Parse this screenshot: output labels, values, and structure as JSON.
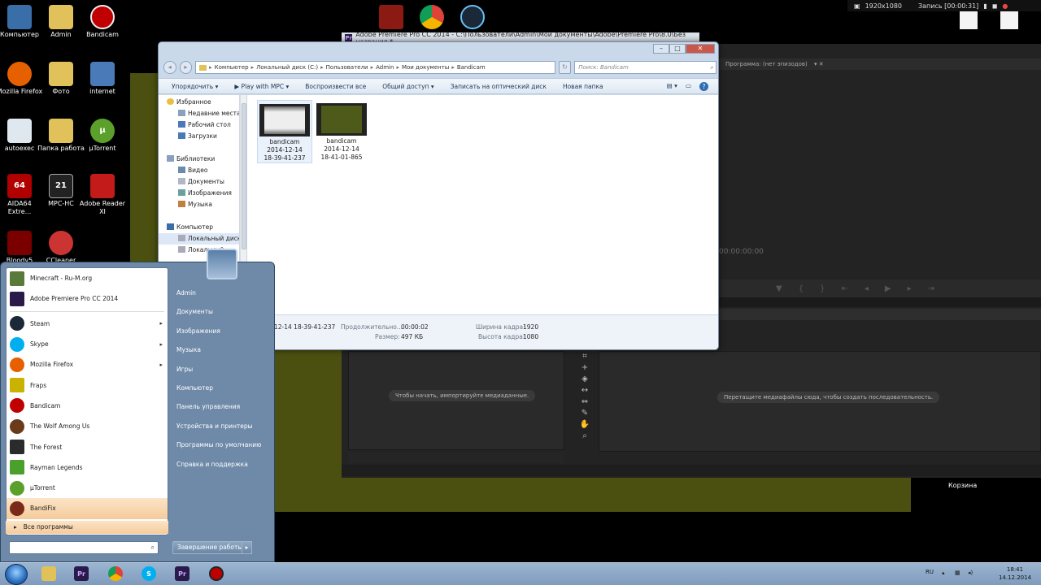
{
  "colors": {
    "olive": "#4b5010",
    "accent": "#f5cb9c",
    "premiere_bg": "#232323"
  },
  "desktop": {
    "icons": [
      {
        "label": "Компьютер",
        "icon": "computer-icon"
      },
      {
        "label": "Admin",
        "icon": "folder-icon"
      },
      {
        "label": "Bandicam",
        "icon": "bandicam-icon"
      },
      {
        "label": "Mozilla Firefox",
        "icon": "firefox-icon"
      },
      {
        "label": "Фото",
        "icon": "folder-icon"
      },
      {
        "label": "internet",
        "icon": "network-icon"
      },
      {
        "label": "autoexec",
        "icon": "file-icon"
      },
      {
        "label": "Папка работа",
        "icon": "folder-icon"
      },
      {
        "label": "µTorrent",
        "icon": "utorrent-icon"
      },
      {
        "label": "AIDA64 Extre...",
        "icon": "aida64-icon"
      },
      {
        "label": "MPC-HC",
        "icon": "mpc-icon"
      },
      {
        "label": "Adobe Reader XI",
        "icon": "adobe-reader-icon"
      },
      {
        "label": "Bloody5",
        "icon": "bloody-icon"
      },
      {
        "label": "CCleaner",
        "icon": "ccleaner-icon"
      }
    ],
    "recycle_bin": "Корзина"
  },
  "record_bar": {
    "resolution": "1920x1080",
    "recording": "Запись [00:00:31]"
  },
  "premiere": {
    "title": "Adobe Premiere Pro CC 2014 - C:\\Пользователи\\Admin\\Мои документы\\Adobe\\Premiere Pro\\8.0\\Без названия *",
    "program_tab": "Программа: (нет эпизодов)",
    "timecode": "00:00:00:00",
    "project_hint": "Чтобы начать, импортируйте медиаданные.",
    "timeline_hint": "Перетащите медиафайлы сюда, чтобы создать последовательность."
  },
  "explorer": {
    "path": [
      "Компьютер",
      "Локальный диск (C:)",
      "Пользователи",
      "Admin",
      "Мои документы",
      "Bandicam"
    ],
    "search_placeholder": "Поиск: Bandicam",
    "toolbar": [
      "Упорядочить",
      "Play with MPC",
      "Воспроизвести все",
      "Общий доступ",
      "Записать на оптический диск",
      "Новая папка"
    ],
    "tree": {
      "favorites": "Избранное",
      "fav_items": [
        "Недавние места",
        "Рабочий стол",
        "Загрузки"
      ],
      "libraries": "Библиотеки",
      "lib_items": [
        "Видео",
        "Документы",
        "Изображения",
        "Музыка"
      ],
      "computer": "Компьютер",
      "comp_items": [
        "Локальный диск",
        "Локальный"
      ]
    },
    "files": [
      {
        "name": "bandicam",
        "date": "2014-12-14",
        "time": "18-39-41-237"
      },
      {
        "name": "bandicam",
        "date": "2014-12-14",
        "time": "18-41-01-865"
      }
    ],
    "details": {
      "name": "12-14 18-39-41-237",
      "duration_label": "Продолжительно...",
      "duration": "00:00:02",
      "size_label": "Размер:",
      "size": "497 КБ",
      "width_label": "Ширина кадра:",
      "width": "1920",
      "height_label": "Высота кадра:",
      "height": "1080"
    }
  },
  "start_menu": {
    "pinned": [
      {
        "label": "Minecraft - Ru-M.org",
        "icon": "minecraft-icon",
        "color": "#5a7a3a"
      },
      {
        "label": "Adobe Premiere Pro CC 2014",
        "icon": "premiere-icon",
        "color": "#2a1a4a"
      }
    ],
    "recent": [
      {
        "label": "Steam",
        "icon": "steam-icon",
        "color": "#1b2838",
        "arrow": true
      },
      {
        "label": "Skype",
        "icon": "skype-icon",
        "color": "#00aff0",
        "arrow": true
      },
      {
        "label": "Mozilla Firefox",
        "icon": "firefox-icon",
        "color": "#e66000",
        "arrow": true
      },
      {
        "label": "Fraps",
        "icon": "fraps-icon",
        "color": "#c9b200",
        "arrow": false
      },
      {
        "label": "Bandicam",
        "icon": "bandicam-icon",
        "color": "#c00000",
        "arrow": false
      },
      {
        "label": "The Wolf Among Us",
        "icon": "wolf-icon",
        "color": "#6a3a1a",
        "arrow": false
      },
      {
        "label": "The Forest",
        "icon": "forest-icon",
        "color": "#2b2b2b",
        "arrow": false
      },
      {
        "label": "Rayman Legends",
        "icon": "rayman-icon",
        "color": "#4aa02a",
        "arrow": false
      },
      {
        "label": "µTorrent",
        "icon": "utorrent-icon",
        "color": "#5aa02a",
        "arrow": false
      },
      {
        "label": "BandiFix",
        "icon": "bandifix-icon",
        "color": "#7a2a1a",
        "arrow": false
      }
    ],
    "all_programs": "Все программы",
    "right": [
      "Admin",
      "Документы",
      "Изображения",
      "Музыка",
      "Игры",
      "Компьютер",
      "Панель управления",
      "Устройства и принтеры",
      "Программы по умолчанию",
      "Справка и поддержка"
    ],
    "shutdown": "Завершение работы"
  },
  "taskbar": {
    "apps": [
      "explorer-icon",
      "premiere-icon",
      "chrome-icon",
      "skype-icon",
      "premiere-icon",
      "bandicam-icon"
    ],
    "lang": "RU",
    "time": "18:41",
    "date": "14.12.2014"
  }
}
